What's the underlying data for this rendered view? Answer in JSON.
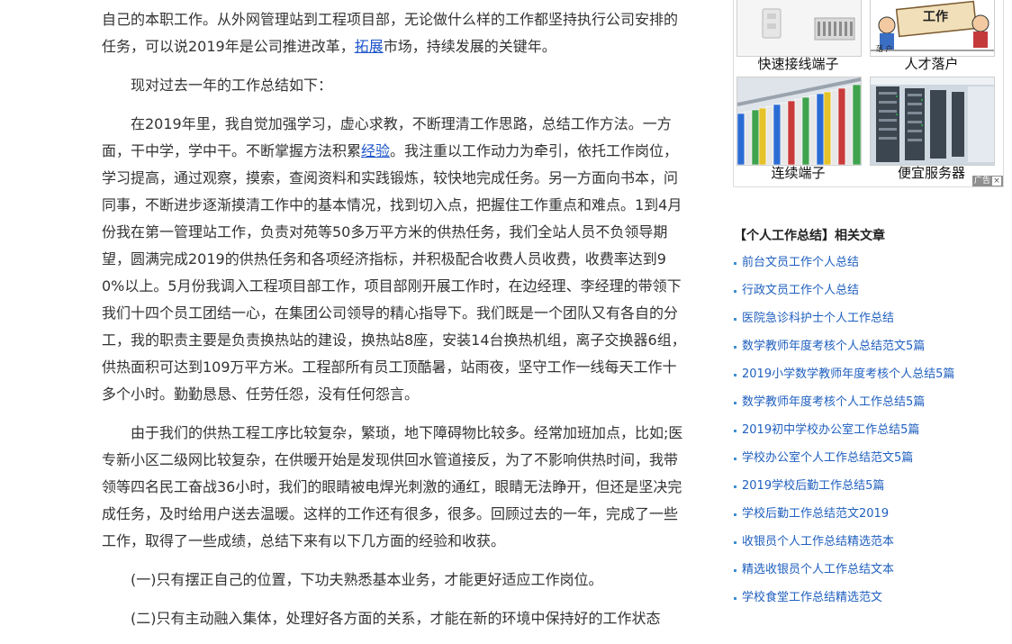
{
  "article": {
    "para1": {
      "before": "自己的本职工作。从外网管理站到工程项目部，无论做什么样的工作都坚持执行公司安排的任务，可以说2019年是公司推进改革，",
      "link": "拓展",
      "after": "市场，持续发展的关键年。"
    },
    "para2": "现对过去一年的工作总结如下：",
    "para3": {
      "before": "在2019年里，我自觉加强学习，虚心求教，不断理清工作思路，总结工作方法。一方面，干中学，学中干。不断掌握方法积累",
      "link": "经验",
      "after": "。我注重以工作动力为牵引，依托工作岗位，学习提高，通过观察，摸索，查阅资料和实践锻炼，较快地完成任务。另一方面向书本，问同事，不断进步逐渐摸清工作中的基本情况，找到切入点，把握住工作重点和难点。1到4月份我在第一管理站工作，负责对苑等50多万平方米的供热任务，我们全站人员不负领导期望，圆满完成2019的供热任务和各项经济指标，并积极配合收费人员收费，收费率达到90%以上。5月份我调入工程项目部工作，项目部刚开展工作时，在边经理、李经理的带领下我们十四个员工团结一心，在集团公司领导的精心指导下。我们既是一个团队又有各自的分工，我的职责主要是负责换热站的建设，换热站8座，安装14台换热机组，离子交换器6组，供热面积可达到109万平方米。工程部所有员工顶酷暑，站雨夜，坚守工作一线每天工作十多个小时。勤勤恳恳、任劳任怨，没有任何怨言。"
    },
    "para4": "由于我们的供热工程工序比较复杂，繁琐，地下障碍物比较多。经常加班加点，比如;医专新小区二级网比较复杂，在供暖开始是发现供回水管道接反，为了不影响供热时间，我带领等四名民工奋战36小时，我们的眼睛被电焊光刺激的通红，眼睛无法睁开，但还是坚决完成任务，及时给用户送去温暖。这样的工作还有很多，很多。回顾过去的一年，完成了一些工作，取得了一些成绩，总结下来有以下几方面的经验和收获。",
    "para5": "(一)只有摆正自己的位置，下功夫熟悉基本业务，才能更好适应工作岗位。",
    "para6": "(二)只有主动融入集体，处理好各方面的关系，才能在新的环境中保持好的工作状态"
  },
  "ads": {
    "items": [
      {
        "caption": "快速接线端子",
        "icon": "terminal-block-icon"
      },
      {
        "caption": "人才落户",
        "icon": "talent-cartoon-icon",
        "img_text": "工作",
        "img_label": "落 户"
      },
      {
        "caption": "连续端子",
        "icon": "continuous-terminal-icon"
      },
      {
        "caption": "便宜服务器",
        "icon": "server-rack-icon"
      }
    ],
    "ad_label": "广告",
    "close_glyph": "×"
  },
  "related": {
    "title": "【个人工作总结】相关文章",
    "items": [
      "前台文员工作个人总结",
      "行政文员工作个人总结",
      "医院急诊科护士个人工作总结",
      "数学教师年度考核个人总结范文5篇",
      "2019小学数学教师年度考核个人总结5篇",
      "数学教师年度考核个人工作总结5篇",
      "2019初中学校办公室工作总结5篇",
      "学校办公室个人工作总结范文5篇",
      "2019学校后勤工作总结5篇",
      "学校后勤工作总结范文2019",
      "收银员个人工作总结精选范本",
      "精选收银员个人工作总结文本",
      "学校食堂工作总结精选范文"
    ]
  },
  "colors": {
    "link": "#1d55c9",
    "related_link": "#1f5fbf",
    "bullet": "#3f8fd0",
    "body_text": "#333333"
  }
}
